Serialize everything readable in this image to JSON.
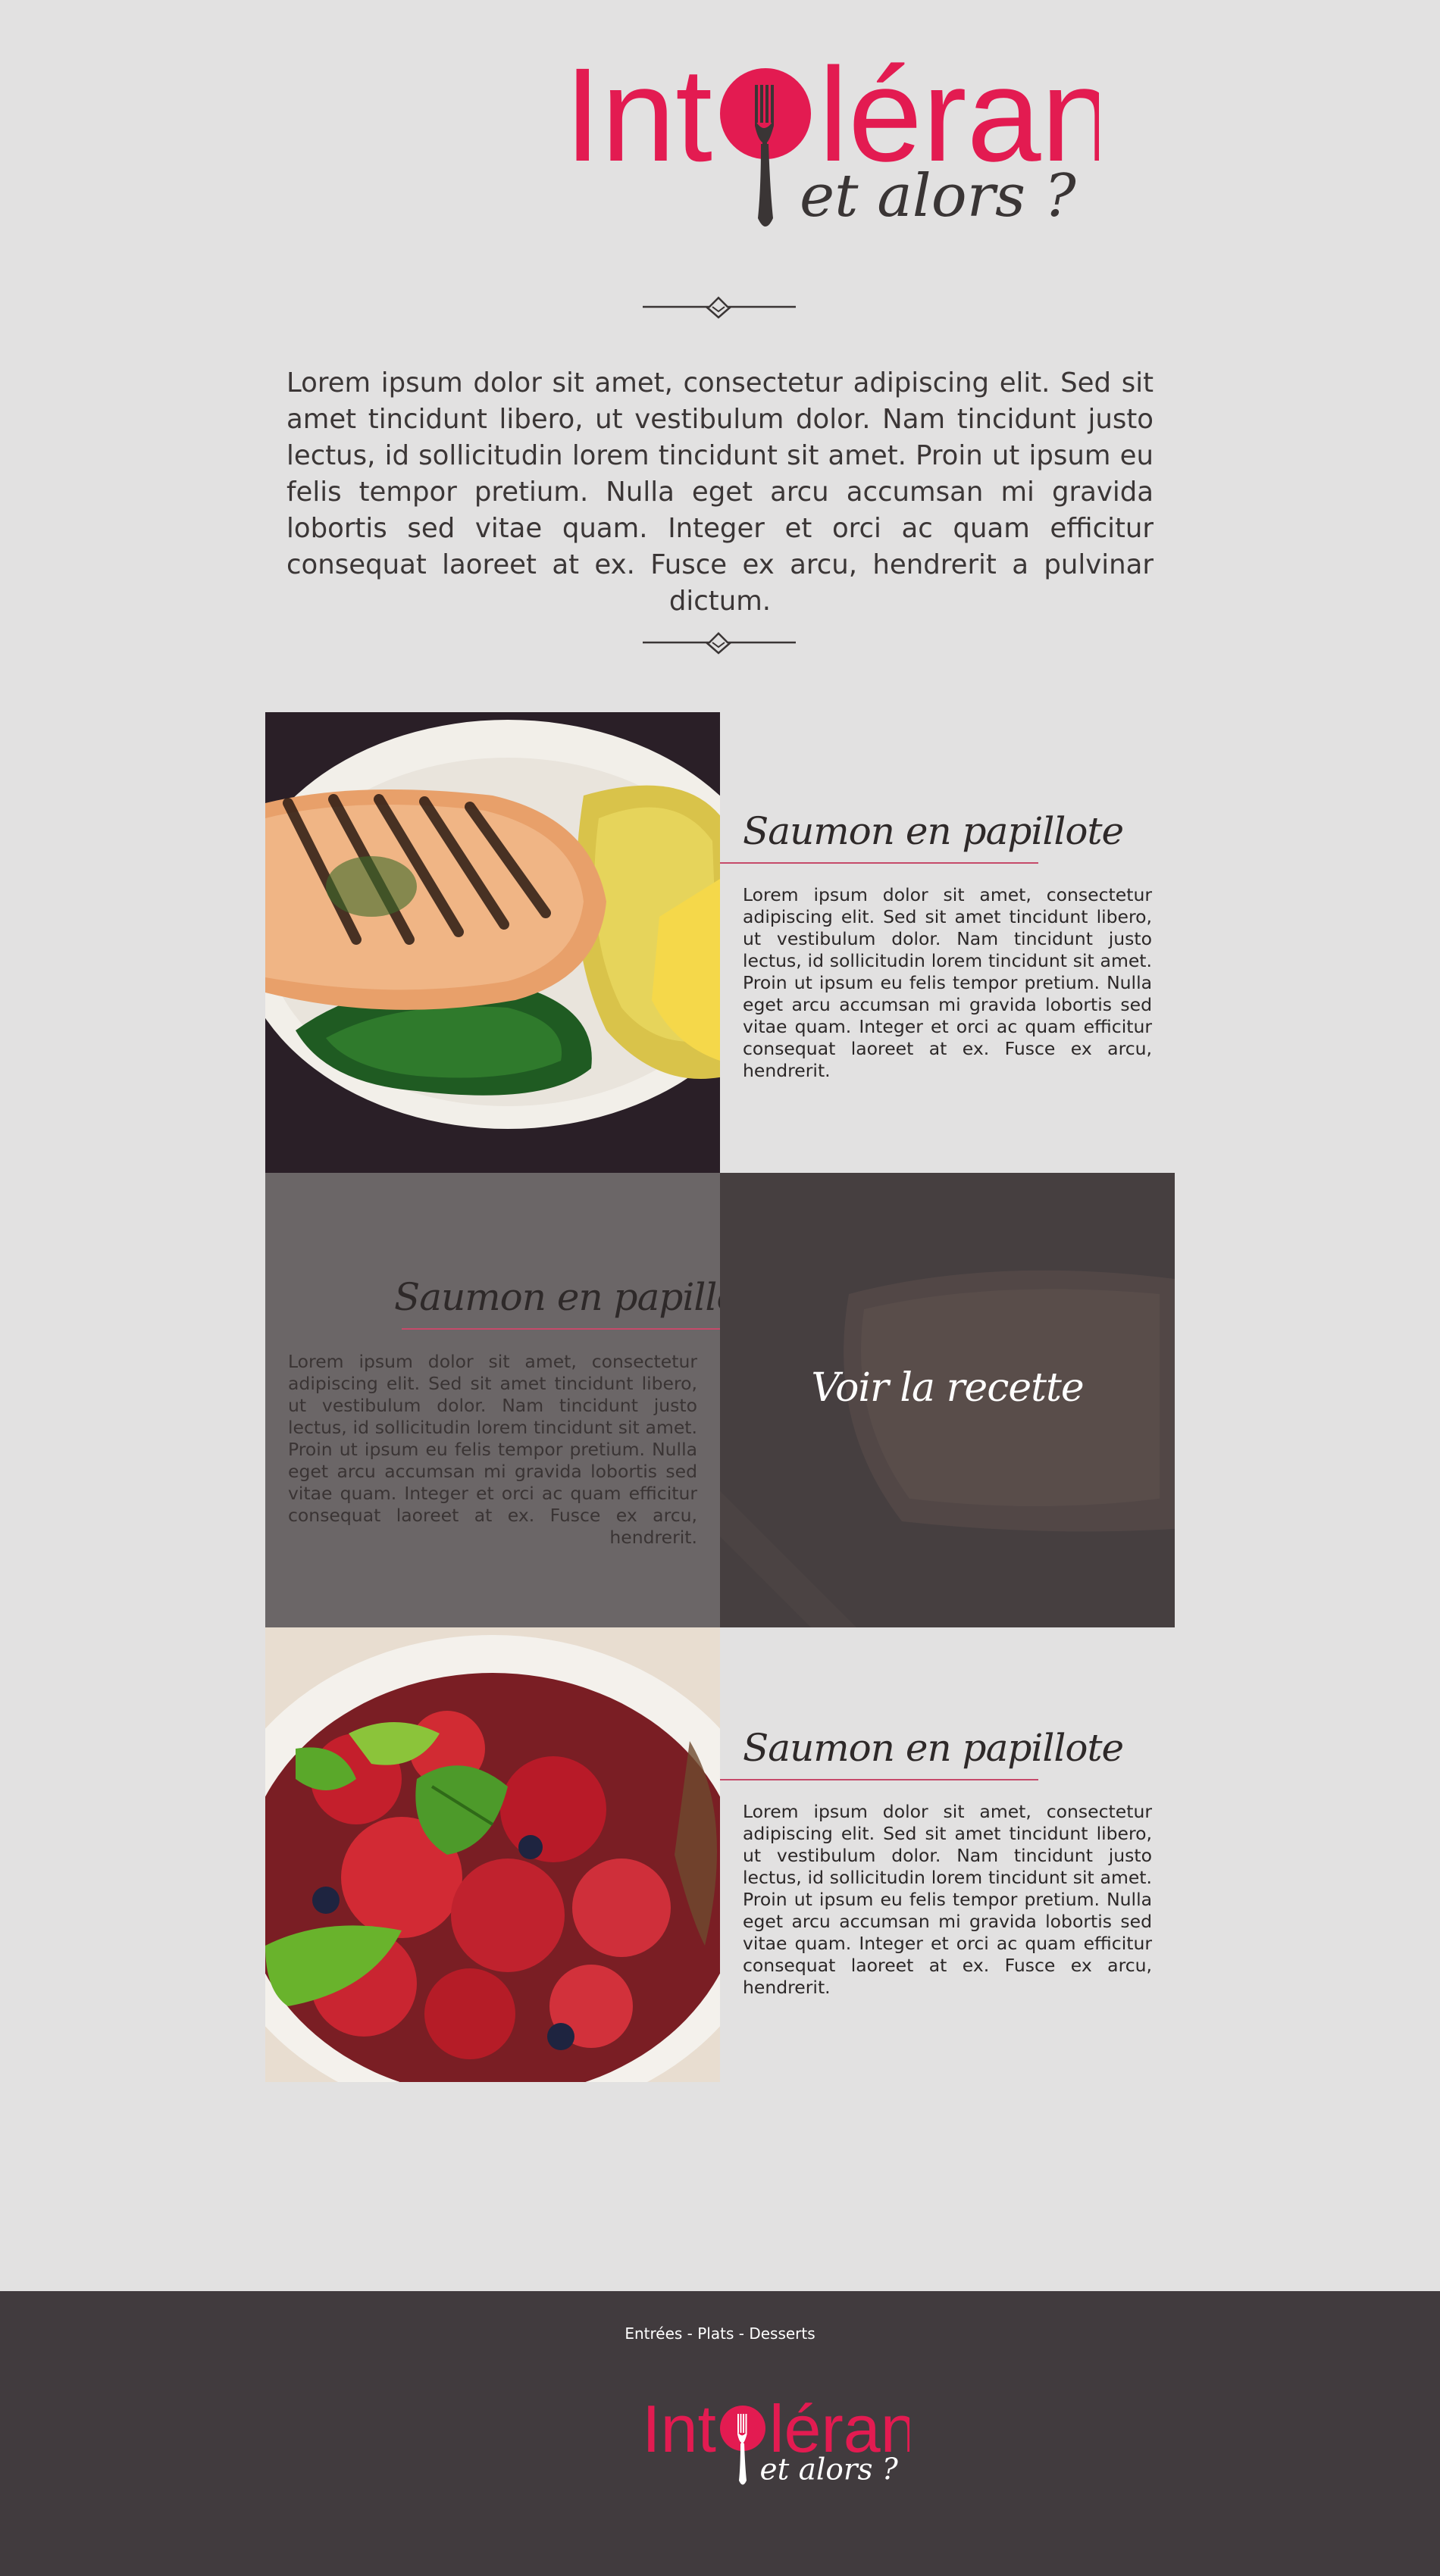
{
  "brand": {
    "name": "Intolérante",
    "name_before": "Int",
    "name_after": "lérante",
    "tagline": "et alors ?",
    "accent_color": "#e31b51",
    "icon": "fork-icon"
  },
  "intro": {
    "text": "Lorem ipsum dolor sit amet, consectetur adipiscing elit. Sed sit amet tincidunt libero, ut vestibulum dolor. Nam tincidunt justo lectus, id sollicitudin lorem tincidunt sit amet. Proin ut ipsum eu felis tempor pretium. Nulla eget arcu accumsan mi gravida lobortis sed vitae quam. Integer et orci ac quam efficitur consequat laoreet at ex. Fusce ex arcu, hendrerit a pulvinar dictum."
  },
  "recipes": [
    {
      "title": "Saumon en papillote",
      "text": "Lorem ipsum dolor sit amet, consectetur adipiscing elit. Sed sit amet tincidunt libero, ut vestibulum dolor. Nam tincidunt justo lectus, id sollicitudin lorem tincidunt sit amet. Proin ut ipsum eu felis tempor pretium. Nulla eget arcu accumsan mi gravida lobortis sed vitae quam. Integer et orci ac quam efficitur consequat laoreet at ex. Fusce ex arcu, hendrerit.",
      "image": "grilled-salmon-photo"
    },
    {
      "title": "Saumon en papillote",
      "text": "Lorem ipsum dolor sit amet, consectetur adipiscing elit. Sed sit amet tincidunt libero, ut vestibulum dolor. Nam tincidunt justo lectus, id sollicitudin lorem tincidunt sit amet. Proin ut ipsum eu felis tempor pretium. Nulla eget arcu accumsan mi gravida lobortis sed vitae quam. Integer et orci ac quam efficitur consequat laoreet at ex. Fusce ex arcu, hendrerit.",
      "image": "tart-photo",
      "cta": "Voir la recette"
    },
    {
      "title": "Saumon en papillote",
      "text": "Lorem ipsum dolor sit amet, consectetur adipiscing elit. Sed sit amet tincidunt libero, ut vestibulum dolor. Nam tincidunt justo lectus, id sollicitudin lorem tincidunt sit amet. Proin ut ipsum eu felis tempor pretium. Nulla eget arcu accumsan mi gravida lobortis sed vitae quam. Integer et orci ac quam efficitur consequat laoreet at ex. Fusce ex arcu, hendrerit.",
      "image": "strawberry-salad-photo"
    }
  ],
  "footer": {
    "nav": [
      "Entrées",
      "Plats",
      "Desserts"
    ],
    "separator": " - "
  },
  "colors": {
    "background": "#e2e1e1",
    "footer": "#413b3e",
    "panel_gray": "#6b6667",
    "panel_dark": "#4a4344",
    "title_underline": "#c64a6a"
  }
}
